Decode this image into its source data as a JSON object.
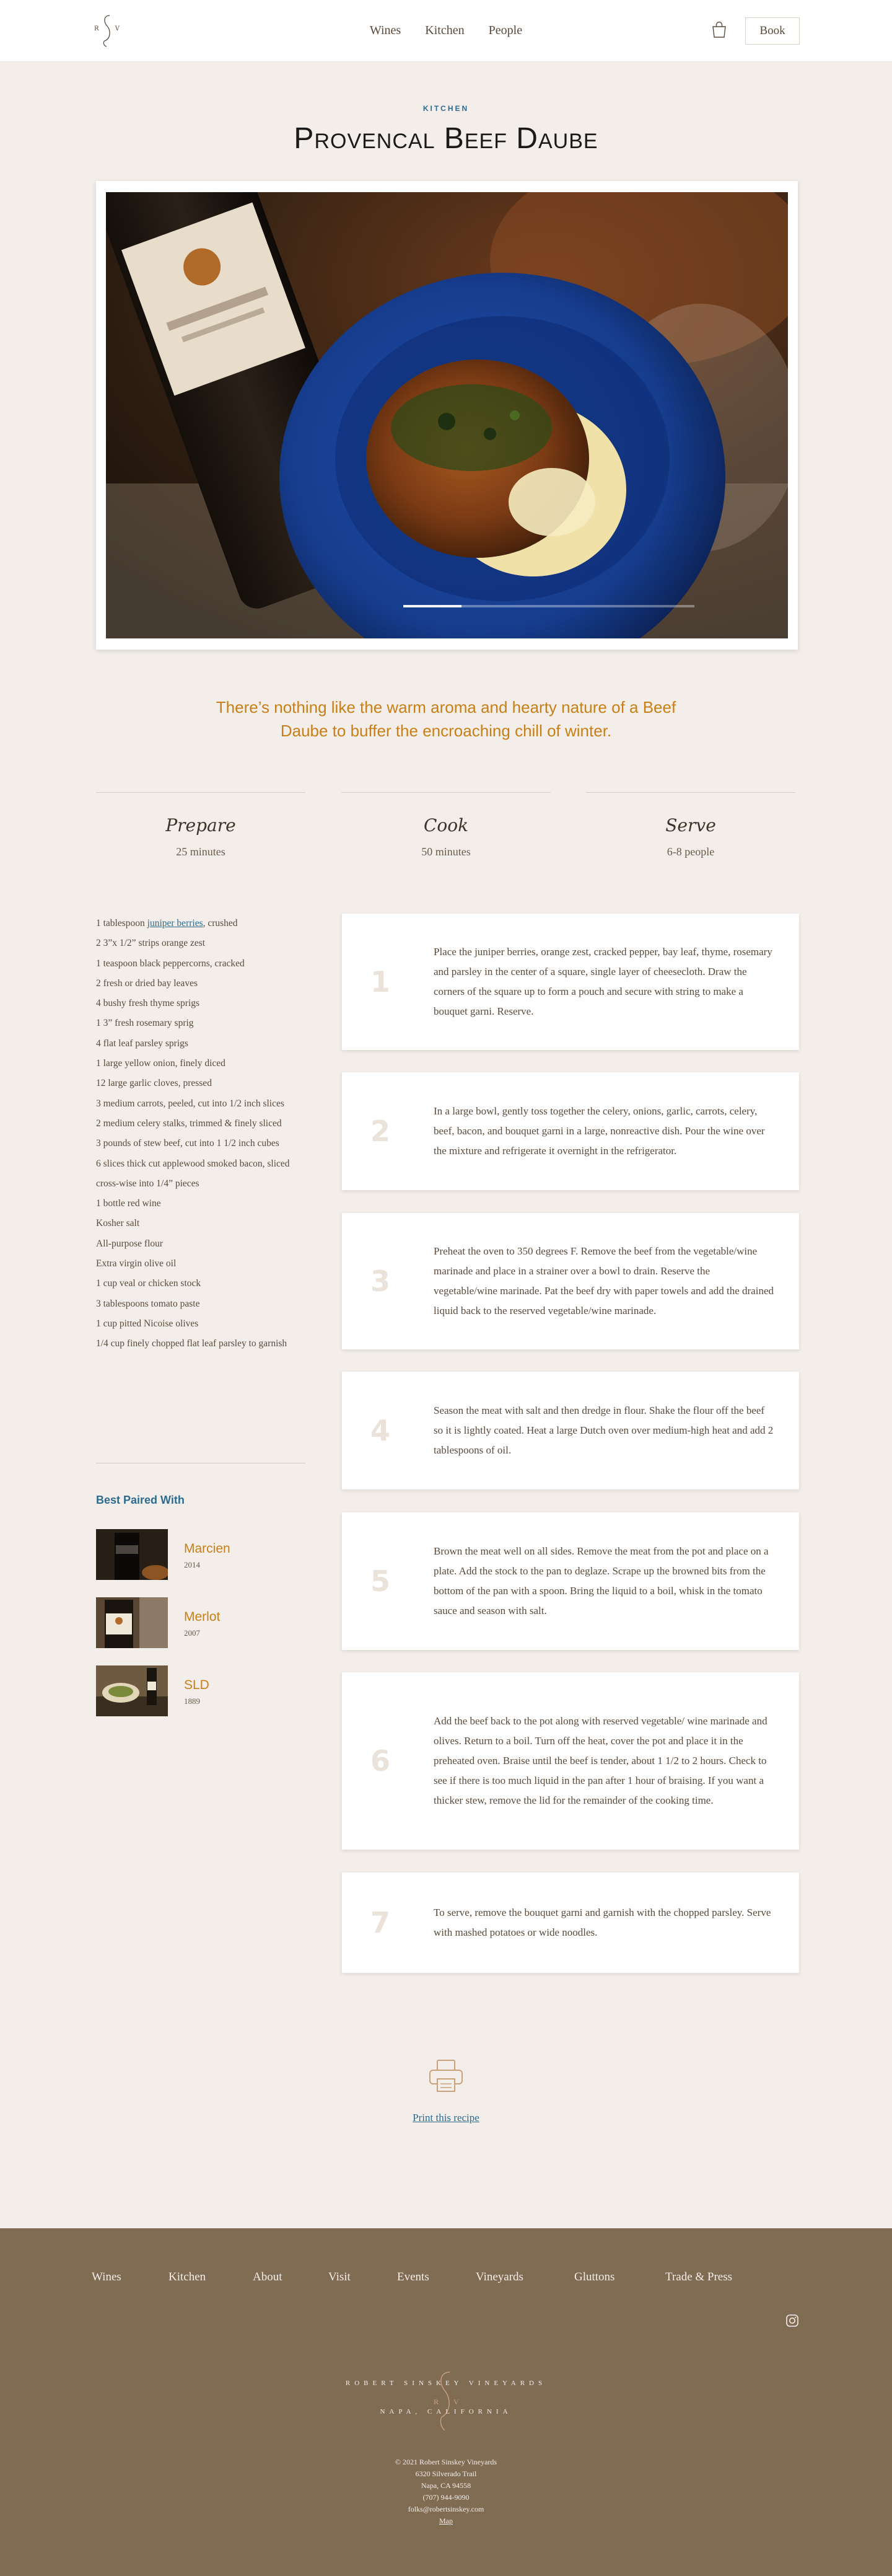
{
  "header": {
    "logo_left": "R",
    "logo_right": "V",
    "nav": [
      "Wines",
      "Kitchen",
      "People"
    ],
    "book_label": "Book"
  },
  "recipe": {
    "category": "KITCHEN",
    "title": "Provencal Beef Daube",
    "slider_progress": 0.2,
    "intro": "There’s nothing like the warm aroma and hearty nature of a Beef Daube to buffer the encroaching chill of winter.",
    "meta": [
      {
        "label": "Prepare",
        "value": "25 minutes"
      },
      {
        "label": "Cook",
        "value": "50 minutes"
      },
      {
        "label": "Serve",
        "value": "6-8 people"
      }
    ],
    "ingredient_link": {
      "before": "1 tablespoon ",
      "link": "juniper berries",
      "after": ", crushed"
    },
    "ingredients": [
      "2 3”x 1/2” strips orange zest",
      "1 teaspoon black peppercorns, cracked",
      "2 fresh or dried bay leaves",
      "4 bushy fresh thyme sprigs",
      "1 3” fresh rosemary sprig",
      "4 flat leaf parsley sprigs",
      "1 large yellow onion, finely diced",
      "12 large garlic cloves, pressed",
      "3 medium carrots, peeled, cut into 1/2 inch slices",
      "2 medium celery stalks, trimmed & finely sliced",
      "3 pounds of stew beef, cut into 1 1/2 inch cubes",
      "6 slices thick cut applewood smoked bacon, sliced cross-wise into 1/4” pieces",
      "1 bottle red wine",
      "Kosher salt",
      "All-purpose flour",
      "Extra virgin olive oil",
      "1 cup veal or chicken stock",
      "3 tablespoons tomato paste",
      "1 cup pitted Nicoise olives",
      "1/4 cup finely chopped flat leaf parsley to garnish"
    ],
    "paired_title": "Best Paired With",
    "wines": [
      {
        "name": "Marcien",
        "year": "2014"
      },
      {
        "name": "Merlot",
        "year": "2007"
      },
      {
        "name": "SLD",
        "year": "1889"
      }
    ],
    "steps": [
      {
        "num": "1",
        "text": "Place the juniper berries, orange zest, cracked pepper, bay leaf, thyme, rosemary and parsley in the center of a square, single layer of cheesecloth. Draw the corners of the square up to form a pouch and secure with string to make a bouquet garni. Reserve."
      },
      {
        "num": "2",
        "text": "In a large bowl, gently toss together the celery, onions, garlic, carrots, celery, beef, bacon, and bouquet garni in a large, nonreactive dish. Pour the wine over the mixture and refrigerate it overnight in the refrigerator."
      },
      {
        "num": "3",
        "text": "Preheat the oven to 350 degrees F. Remove the beef from the vegetable/wine marinade and place in a strainer over a bowl to drain. Reserve the vegetable/wine marinade. Pat the beef dry with paper towels and add the drained liquid back to the reserved vegetable/wine marinade."
      },
      {
        "num": "4",
        "text": "Season the meat with salt and then dredge in flour. Shake the flour off the beef so it is lightly coated. Heat a large Dutch oven over medium-high heat and add 2 tablespoons of oil."
      },
      {
        "num": "5",
        "text": "Brown the meat well on all sides. Remove the meat from the pot and place on a plate. Add the stock to the pan to deglaze. Scrape up the browned bits from the bottom of the pan with a spoon. Bring the liquid to a boil, whisk in the tomato sauce and season with salt."
      },
      {
        "num": "6",
        "text": "Add the beef back to the pot along with reserved vegetable/ wine marinade and olives. Return to a boil. Turn off the heat, cover the pot and place it in the preheated oven. Braise until the beef is tender, about 1 1/2 to 2 hours. Check to see if there is too much liquid in the pan after 1 hour of braising. If you want a thicker stew, remove the lid for the remainder of the cooking time."
      },
      {
        "num": "7",
        "text": "To serve, remove the bouquet garni and garnish with the chopped parsley. Serve with mashed potatoes or wide noodles."
      }
    ],
    "print_label": "Print this recipe"
  },
  "footer": {
    "nav": [
      "Wines",
      "Kitchen",
      "About",
      "Visit",
      "Events",
      "Vineyards",
      "Gluttons",
      "Trade & Press"
    ],
    "logo_top": "ROBERT SINSKEY VINEYARDS",
    "logo_bottom": "NAPA, CALIFORNIA",
    "copyright": "© 2021 Robert Sinskey Vineyards",
    "street": "6320 Silverado Trail",
    "city": "Napa, CA 94558",
    "phone": "(707) 944-9090",
    "email": "folks@robertsinskey.com",
    "map_label": "Map"
  },
  "icons": {
    "bag": "shopping-bag-icon",
    "print": "printer-icon",
    "social": "instagram-icon"
  },
  "colors": {
    "accent_blue": "#2c6b8f",
    "accent_gold": "#c97f18",
    "footer_bg": "#806b53",
    "page_bg": "#f3eee9"
  }
}
